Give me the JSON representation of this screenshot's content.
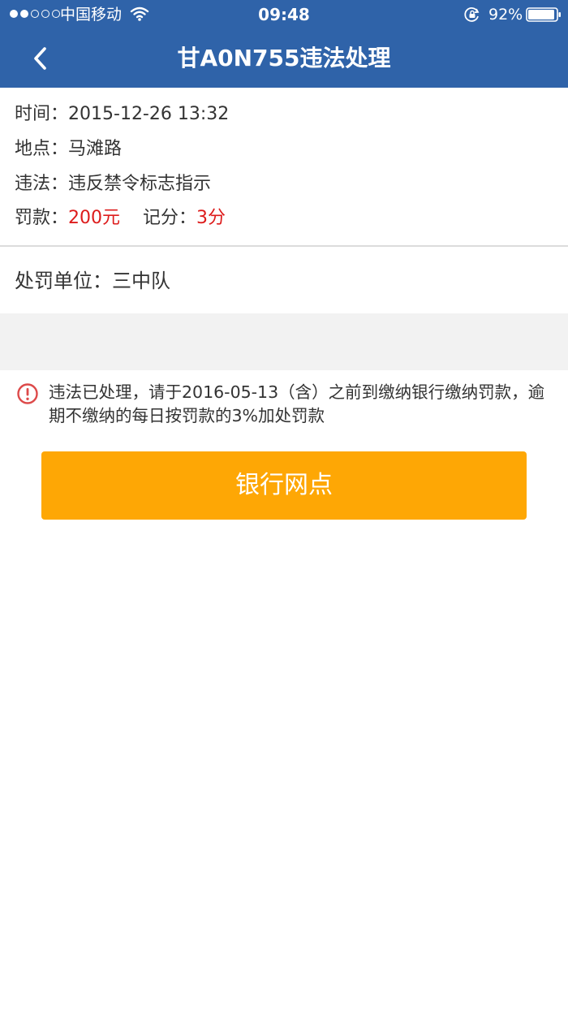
{
  "status_bar": {
    "carrier": "中国移动",
    "time": "09:48",
    "battery": "92%",
    "icons": [
      "signal-dots",
      "wifi-icon",
      "rotation-lock-icon",
      "battery-icon"
    ]
  },
  "nav": {
    "back_icon": "chevron-left-icon",
    "title": "甘A0N755违法处理"
  },
  "info": {
    "time_label": "时间：",
    "time_value": "2015-12-26 13:32",
    "place_label": "地点：",
    "place_value": "马滩路",
    "violation_label": "违法：",
    "violation_value": "违反禁令标志指示",
    "fine_label": "罚款：",
    "fine_value": "200元",
    "points_label": "记分：",
    "points_value": "3分"
  },
  "unit": {
    "label": "处罚单位：",
    "value": "三中队"
  },
  "notice": {
    "icon": "info-circle-icon",
    "text": "违法已处理，请于2016-05-13（含）之前到缴纳银行缴纳罚款，逾期不缴纳的每日按罚款的3%加处罚款"
  },
  "button": {
    "label": "银行网点"
  },
  "colors": {
    "header": "#2f63a9",
    "accent_red": "#dd1c1c",
    "button": "#fea705"
  }
}
